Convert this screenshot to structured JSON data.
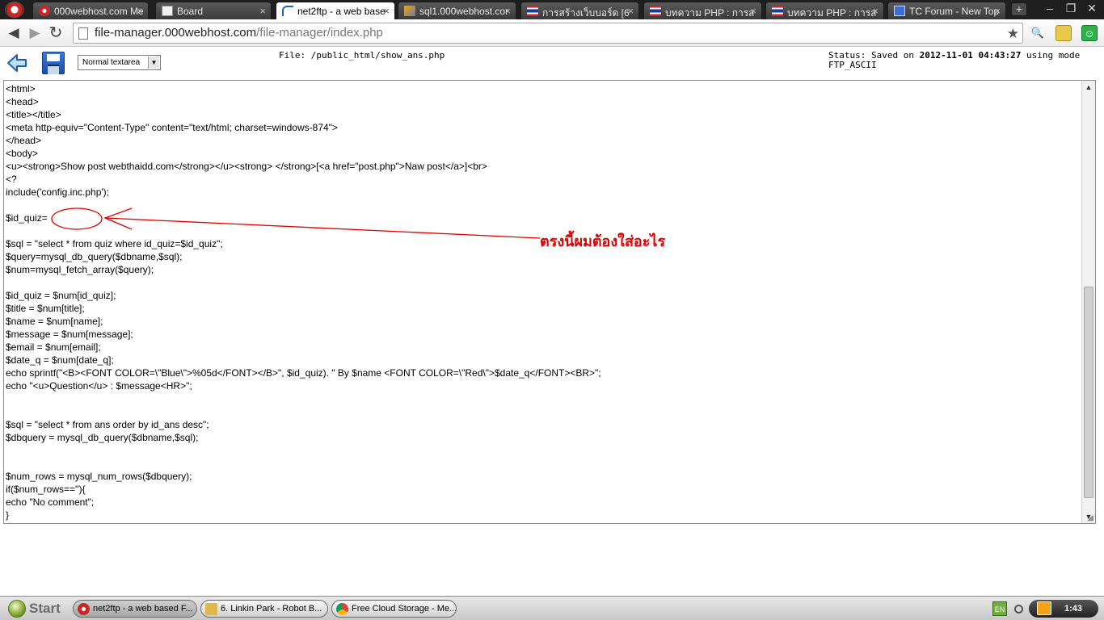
{
  "browser": {
    "tabs": [
      {
        "label": "000webhost.com Me",
        "favicon": "red-circle-icon"
      },
      {
        "label": "Board",
        "favicon": "document-icon"
      },
      {
        "label": "net2ftp - a web base",
        "favicon": "net2ftp-icon",
        "active": true
      },
      {
        "label": "sql1.000webhost.cor",
        "favicon": "phpmyadmin-icon"
      },
      {
        "label": "การสร้างเว็บบอร์ด [6",
        "favicon": "thai-flag-icon"
      },
      {
        "label": "บทความ PHP : การส",
        "favicon": "thai-flag-icon"
      },
      {
        "label": "บทความ PHP : การส",
        "favicon": "thai-flag-icon"
      },
      {
        "label": "TC Forum - New Top",
        "favicon": "forum-icon"
      }
    ],
    "tab_close": "×",
    "new_tab": "+",
    "window_controls": {
      "minimize": "–",
      "restore": "❐",
      "close": "✕"
    },
    "nav": {
      "back": "◀",
      "forward": "▶",
      "reload": "↻"
    },
    "url_host": "file-manager.000webhost.com",
    "url_path": "/file-manager/index.php",
    "bookmark_star": "★"
  },
  "editor": {
    "mode_select": "Normal textarea",
    "file_label": "File: /public_html/show_ans.php",
    "status_prefix": "Status: Saved on ",
    "status_datetime": "2012-11-01 04:43:27",
    "status_suffix": " using mode FTP_ASCII",
    "code": "<html>\n<head>\n<title></title>\n<meta http-equiv=\"Content-Type\" content=\"text/html; charset=windows-874\">\n</head>\n<body>\n<u><strong>Show post webthaidd.com</strong></u><strong> </strong>[<a href=\"post.php\">Naw post</a>]<br>\n<?\ninclude('config.inc.php');\n\n$id_quiz=\n\n$sql = \"select * from quiz where id_quiz=$id_quiz\";\n$query=mysql_db_query($dbname,$sql);\n$num=mysql_fetch_array($query);\n\n$id_quiz = $num[id_quiz];\n$title = $num[title];\n$name = $num[name];\n$message = $num[message];\n$email = $num[email];\n$date_q = $num[date_q];\necho sprintf(\"<B><FONT COLOR=\\\"Blue\\\">%05d</FONT></B>\", $id_quiz). \" By $name <FONT COLOR=\\\"Red\\\">$date_q</FONT><BR>\";\necho \"<u>Question</u> : $message<HR>\";\n\n\n$sql = \"select * from ans order by id_ans desc\";\n$dbquery = mysql_db_query($dbname,$sql);\n\n\n$num_rows = mysql_num_rows($dbquery);\nif($num_rows==''){\necho \"No comment\";\n}",
    "annotation": "ตรงนี้ผมต้องใส่อะไร"
  },
  "taskbar": {
    "start": "Start",
    "items": [
      {
        "label": "net2ftp - a web based F...",
        "active": true
      },
      {
        "label": "6. Linkin Park - Robot B..."
      },
      {
        "label": "Free Cloud Storage - Me..."
      }
    ],
    "tray_lang": "EN",
    "clock": "1:43"
  },
  "colors": {
    "annotation": "#e00000",
    "titlebar": "#1f1f1f"
  }
}
